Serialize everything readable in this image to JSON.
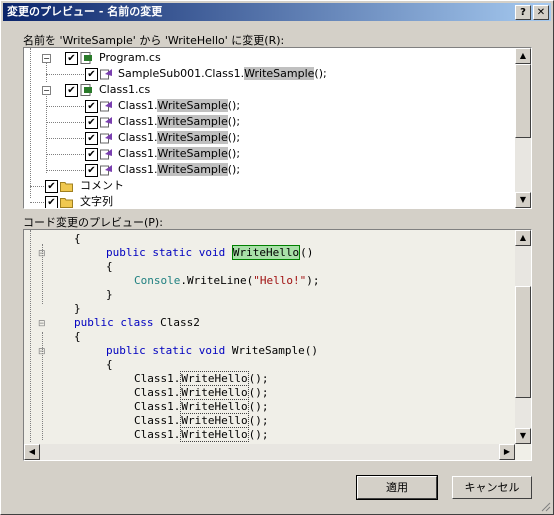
{
  "window": {
    "title": "変更のプレビュー - 名前の変更",
    "help_label": "?",
    "close_label": "✕"
  },
  "top_label": "名前を 'WriteSample' から 'WriteHello' に変更(R):",
  "tree": [
    {
      "text": "Program.cs",
      "icon": "cs-file-icon"
    },
    {
      "pre": "SampleSub001.Class1.",
      "hl": "WriteSample",
      "post": "();",
      "icon": "method-icon"
    },
    {
      "text": "Class1.cs",
      "icon": "cs-file-icon"
    },
    {
      "pre": "Class1.",
      "hl": "WriteSample",
      "post": "();",
      "icon": "method-icon"
    },
    {
      "pre": "Class1.",
      "hl": "WriteSample",
      "post": "();",
      "icon": "method-icon"
    },
    {
      "pre": "Class1.",
      "hl": "WriteSample",
      "post": "();",
      "icon": "method-icon"
    },
    {
      "pre": "Class1.",
      "hl": "WriteSample",
      "post": "();",
      "icon": "method-icon"
    },
    {
      "pre": "Class1.",
      "hl": "WriteSample",
      "post": "();",
      "icon": "method-icon"
    },
    {
      "text": "コメント",
      "icon": "folder-icon"
    },
    {
      "text": "文字列",
      "icon": "folder-icon"
    }
  ],
  "code_label": "コード変更のプレビュー(P):",
  "code": {
    "brace": "{",
    "close": "}",
    "public": "public",
    "static": "static",
    "void": "void",
    "class": "class",
    "class2": "Class2",
    "newname": "WriteHello",
    "paren": "()",
    "console": "Console",
    "writeline": ".WriteLine(",
    "hello": "\"Hello!\"",
    "end": ");",
    "oldcall": "WriteSample()",
    "class1": "Class1.",
    "callend": "();"
  },
  "buttons": {
    "apply": "適用",
    "cancel": "キャンセル"
  }
}
